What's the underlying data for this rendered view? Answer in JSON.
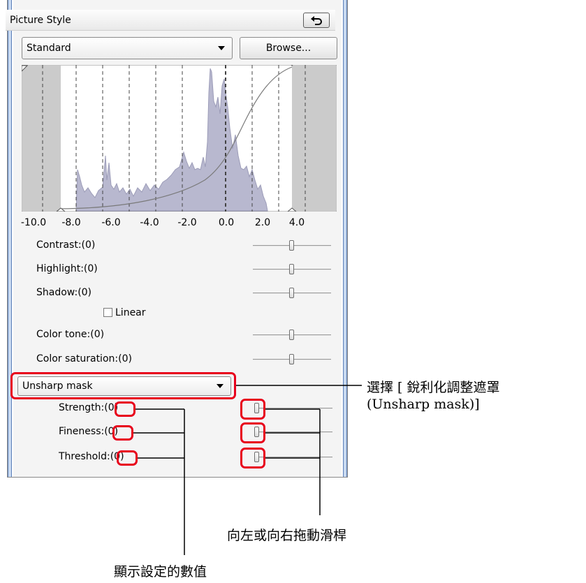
{
  "panel": {
    "title": "Picture Style",
    "style_select": "Standard",
    "browse_label": "Browse..."
  },
  "histogram": {
    "x_ticks": [
      "-10.0",
      "-8.0",
      "-6.0",
      "-4.0",
      "-2.0",
      "0.0",
      "2.0",
      "4.0"
    ]
  },
  "basic_sliders": [
    {
      "label": "Contrast:(0)",
      "value": 0
    },
    {
      "label": "Highlight:(0)",
      "value": 0
    },
    {
      "label": "Shadow:(0)",
      "value": 0
    },
    {
      "label": "Color tone:(0)",
      "value": 0
    },
    {
      "label": "Color saturation:(0)",
      "value": 0
    }
  ],
  "linear_label": "Linear",
  "sharpness_select": "Unsharp mask",
  "sharpness_sliders": [
    {
      "name": "Strength:",
      "value_text": "(0)",
      "value": 0
    },
    {
      "name": "Fineness:",
      "value_text": "(0)",
      "value": 0
    },
    {
      "name": "Threshold:",
      "value_text": "(0)",
      "value": 0
    }
  ],
  "annotations": {
    "select_line1": "選擇 [ 銳利化調整遮罩",
    "select_line2": "(Unsharp mask)]",
    "drag_slider": "向左或向右拖動滑桿",
    "shows_value": "顯示設定的數值"
  },
  "colors": {
    "highlight_red": "#e8001c",
    "histogram_fill": "#b8b8cf",
    "frame_blue": "#c9daf1"
  },
  "icons": {
    "undo": "undo-arrow-icon",
    "dropdown": "chevron-down-icon"
  }
}
